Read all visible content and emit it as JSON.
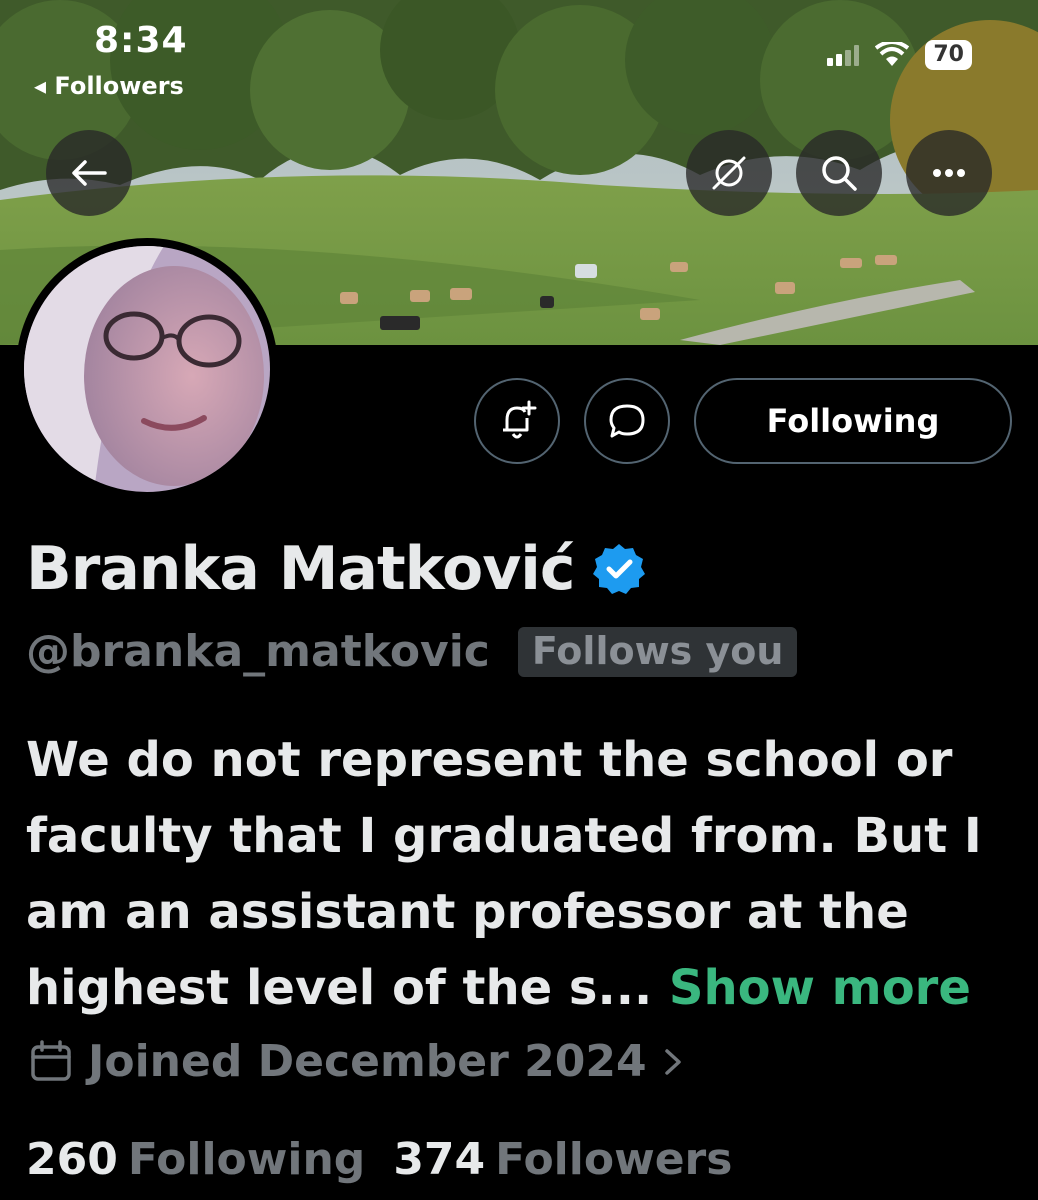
{
  "status_bar": {
    "time": "8:34",
    "back_label": "Followers",
    "battery": "70"
  },
  "header": {
    "back_icon": "arrow-left-icon",
    "icons": [
      "grok-slash-icon",
      "search-icon",
      "more-icon"
    ]
  },
  "actions": {
    "notify_icon": "bell-plus-icon",
    "message_icon": "chat-bubble-icon",
    "following_label": "Following"
  },
  "profile": {
    "name": "Branka Matković",
    "verified": true,
    "handle": "@branka_matkovic",
    "follows_you": "Follows you",
    "bio": "We do not represent the school or faculty that I graduated from. But I am an assistant professor at the highest level of the s...",
    "show_more": "Show more",
    "joined": "Joined December 2024"
  },
  "stats": {
    "following_count": "260",
    "following_label": "Following",
    "followers_count": "374",
    "followers_label": "Followers"
  },
  "colors": {
    "background": "#000000",
    "accent_green": "#3ab77f",
    "verified_blue": "#1d9bf0",
    "muted": "#71767b"
  }
}
